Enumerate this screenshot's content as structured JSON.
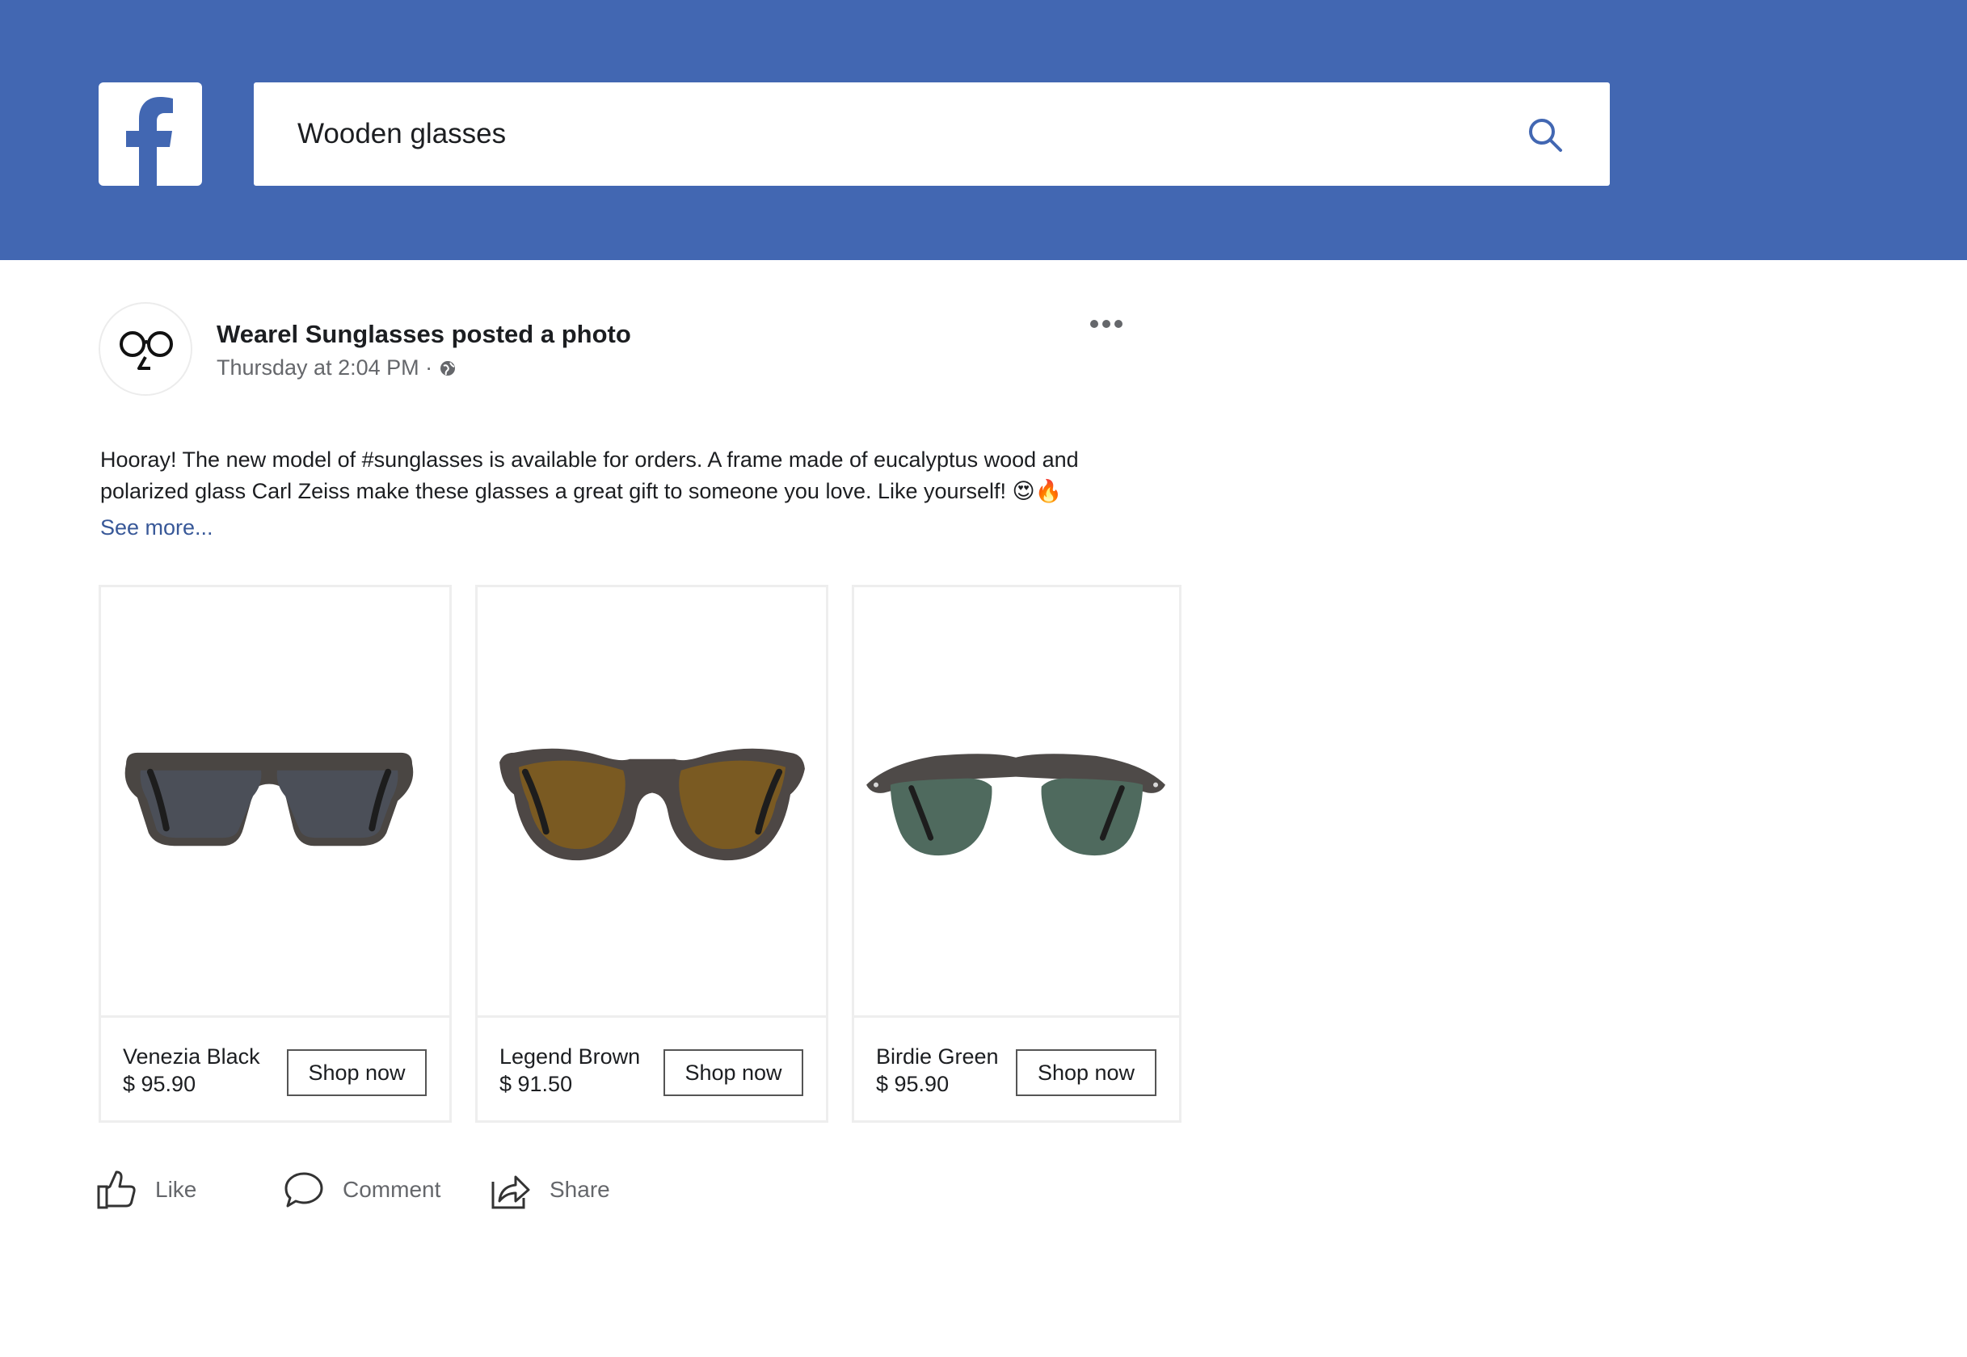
{
  "header": {
    "search_value": "Wooden glasses",
    "brand_color": "#4267b2",
    "logo_icon": "facebook-logo-icon",
    "search_icon": "search-icon"
  },
  "post": {
    "author_line": "Wearel Sunglasses posted a photo",
    "timestamp": "Thursday at 2:04 PM ·",
    "audience_icon": "globe-icon",
    "menu_icon": "more-horizontal-icon",
    "text": "Hooray! The new model of #sunglasses is available for orders. A frame made of eucalyptus wood and polarized glass Carl Zeiss make these glasses a great gift to someone you love. Like yourself! 😍🔥",
    "see_more": "See more..."
  },
  "products": [
    {
      "name": "Venezia Black",
      "price": "$ 95.90",
      "button": "Shop now",
      "lens_color": "#4b4f58"
    },
    {
      "name": "Legend Brown",
      "price": "$ 91.50",
      "button": "Shop now",
      "lens_color": "#7a5a22"
    },
    {
      "name": "Birdie Green",
      "price": "$ 95.90",
      "button": "Shop now",
      "lens_color": "#4f6a5e"
    }
  ],
  "actions": {
    "like": "Like",
    "comment": "Comment",
    "share": "Share"
  }
}
